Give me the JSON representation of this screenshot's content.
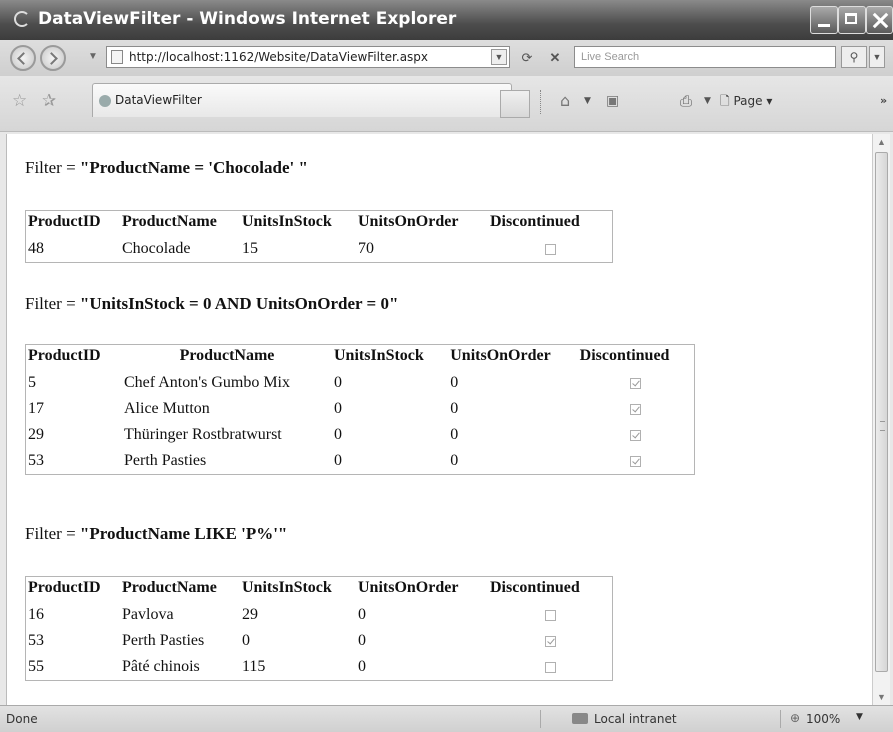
{
  "window": {
    "title": "DataViewFilter - Windows Internet Explorer"
  },
  "address": {
    "url": "http://localhost:1162/Website/DataViewFilter.aspx",
    "search_placeholder": "Live Search"
  },
  "tab": {
    "label": "DataViewFilter"
  },
  "command_bar": {
    "page_label": "Page"
  },
  "icons": {
    "back": "back-arrow-icon",
    "forward": "forward-arrow-icon",
    "refresh": "refresh-icon",
    "stop": "stop-icon",
    "search": "search-icon",
    "favorites": "favorites-star-icon",
    "add_favorites": "add-favorites-icon",
    "home": "home-icon",
    "feeds": "feeds-icon",
    "print": "print-icon",
    "page": "page-icon",
    "zone": "local-intranet-icon",
    "zoom": "zoom-icon"
  },
  "sections": [
    {
      "filter_prefix": "Filter = ",
      "filter_expr": "\"ProductName = 'Chocolade' \"",
      "columns": [
        "ProductID",
        "ProductName",
        "UnitsInStock",
        "UnitsOnOrder",
        "Discontinued"
      ],
      "rows": [
        {
          "id": "48",
          "name": "Chocolade",
          "stock": "15",
          "order": "70",
          "discontinued": false
        }
      ]
    },
    {
      "filter_prefix": "Filter = ",
      "filter_expr": "\"UnitsInStock = 0 AND UnitsOnOrder = 0\"",
      "columns": [
        "ProductID",
        "ProductName",
        "UnitsInStock",
        "UnitsOnOrder",
        "Discontinued"
      ],
      "rows": [
        {
          "id": "5",
          "name": "Chef Anton's Gumbo Mix",
          "stock": "0",
          "order": "0",
          "discontinued": true
        },
        {
          "id": "17",
          "name": "Alice Mutton",
          "stock": "0",
          "order": "0",
          "discontinued": true
        },
        {
          "id": "29",
          "name": "Thüringer Rostbratwurst",
          "stock": "0",
          "order": "0",
          "discontinued": true
        },
        {
          "id": "53",
          "name": "Perth Pasties",
          "stock": "0",
          "order": "0",
          "discontinued": true
        }
      ]
    },
    {
      "filter_prefix": "Filter = ",
      "filter_expr": "\"ProductName LIKE 'P%'\"",
      "columns": [
        "ProductID",
        "ProductName",
        "UnitsInStock",
        "UnitsOnOrder",
        "Discontinued"
      ],
      "rows": [
        {
          "id": "16",
          "name": "Pavlova",
          "stock": "29",
          "order": "0",
          "discontinued": false
        },
        {
          "id": "53",
          "name": "Perth Pasties",
          "stock": "0",
          "order": "0",
          "discontinued": true
        },
        {
          "id": "55",
          "name": "Pâté chinois",
          "stock": "115",
          "order": "0",
          "discontinued": false
        }
      ]
    }
  ],
  "status": {
    "left": "Done",
    "zone": "Local intranet",
    "zoom": "100%"
  }
}
